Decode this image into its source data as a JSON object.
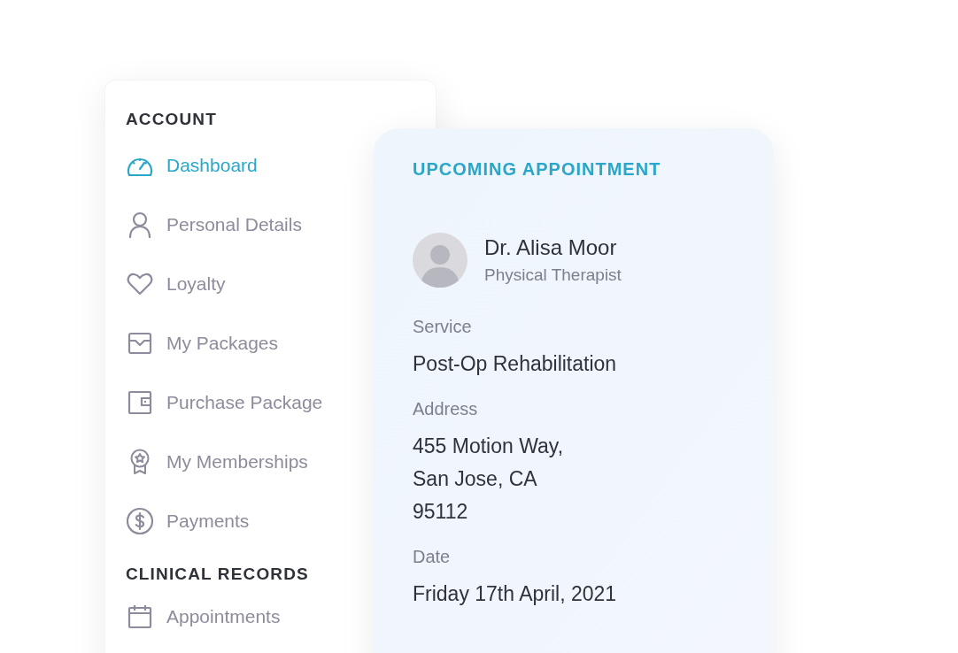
{
  "sidebar": {
    "sections": [
      {
        "title": "ACCOUNT",
        "items": [
          {
            "label": "Dashboard",
            "selected": true
          },
          {
            "label": "Personal Details",
            "selected": false
          },
          {
            "label": "Loyalty",
            "selected": false
          },
          {
            "label": "My Packages",
            "selected": false
          },
          {
            "label": "Purchase Package",
            "selected": false
          },
          {
            "label": "My Memberships",
            "selected": false
          },
          {
            "label": "Payments",
            "selected": false
          }
        ]
      },
      {
        "title": "CLINICAL RECORDS",
        "items": [
          {
            "label": "Appointments",
            "selected": false
          }
        ]
      }
    ]
  },
  "appointment": {
    "title": "UPCOMING APPOINTMENT",
    "practitioner": {
      "name": "Dr. Alisa Moor",
      "role": "Physical Therapist"
    },
    "fields": [
      {
        "label": "Service",
        "lines": [
          "Post-Op Rehabilitation"
        ]
      },
      {
        "label": "Address",
        "lines": [
          "455 Motion Way,",
          "San Jose, CA",
          "95112"
        ]
      },
      {
        "label": "Date",
        "lines": [
          "Friday 17th April, 2021"
        ]
      }
    ]
  }
}
